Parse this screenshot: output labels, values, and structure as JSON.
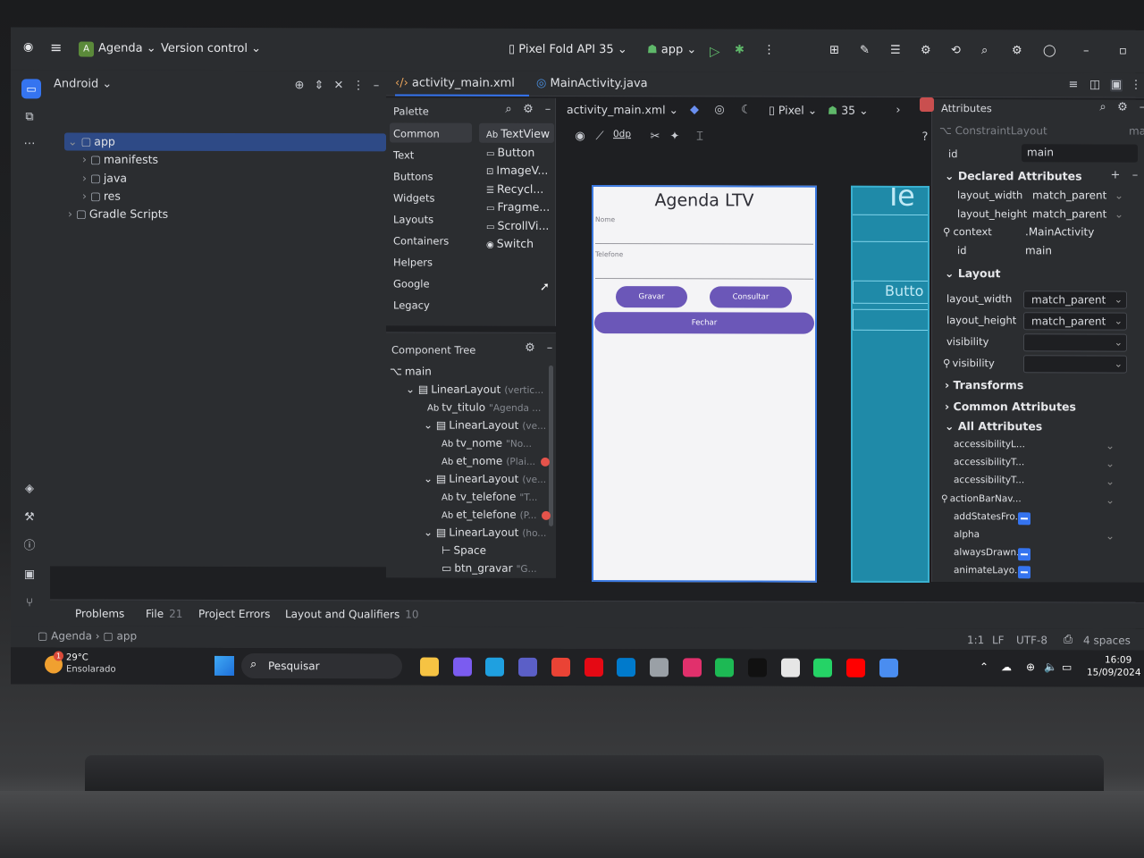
{
  "titlebar": {
    "project_badge": "A",
    "project_name": "Agenda",
    "version_control": "Version control",
    "device": "Pixel Fold API 35",
    "run_config": "app"
  },
  "project_panel": {
    "view_mode": "Android",
    "tree": [
      {
        "label": "app",
        "level": 0,
        "expanded": true,
        "selected": true
      },
      {
        "label": "manifests",
        "level": 1
      },
      {
        "label": "java",
        "level": 1
      },
      {
        "label": "res",
        "level": 1
      },
      {
        "label": "Gradle Scripts",
        "level": 0
      }
    ]
  },
  "editor_tabs": [
    {
      "label": "activity_main.xml",
      "active": true
    },
    {
      "label": "MainActivity.java",
      "active": false
    }
  ],
  "palette": {
    "title": "Palette",
    "categories": [
      "Common",
      "Text",
      "Buttons",
      "Widgets",
      "Layouts",
      "Containers",
      "Helpers",
      "Google",
      "Legacy"
    ],
    "items": [
      "TextView",
      "Button",
      "ImageV...",
      "Recycl...",
      "Fragme...",
      "ScrollVi...",
      "Switch"
    ]
  },
  "design_toolbar": {
    "file": "activity_main.xml",
    "device": "Pixel",
    "api": "35",
    "margin": "0dp"
  },
  "component_tree": {
    "title": "Component Tree",
    "rows": [
      {
        "name": "main",
        "hint": "",
        "indent": 0,
        "error": false
      },
      {
        "name": "LinearLayout",
        "hint": "(vertic...",
        "indent": 1,
        "error": false
      },
      {
        "name": "tv_titulo",
        "hint": "\"Agenda ...",
        "indent": 2,
        "error": false
      },
      {
        "name": "LinearLayout",
        "hint": "(ve...",
        "indent": 2,
        "error": false
      },
      {
        "name": "tv_nome",
        "hint": "\"No...",
        "indent": 3,
        "error": false
      },
      {
        "name": "et_nome",
        "hint": "(Plai...",
        "indent": 3,
        "error": true
      },
      {
        "name": "LinearLayout",
        "hint": "(ve...",
        "indent": 2,
        "error": false
      },
      {
        "name": "tv_telefone",
        "hint": "\"T...",
        "indent": 3,
        "error": false
      },
      {
        "name": "et_telefone",
        "hint": "(P...",
        "indent": 3,
        "error": true
      },
      {
        "name": "LinearLayout",
        "hint": "(ho...",
        "indent": 2,
        "error": false
      },
      {
        "name": "Space",
        "hint": "",
        "indent": 3,
        "error": false
      },
      {
        "name": "btn_gravar",
        "hint": "\"G...",
        "indent": 3,
        "error": false
      }
    ]
  },
  "preview": {
    "title": "Agenda LTV",
    "field1_label": "Nome",
    "field2_label": "Telefone",
    "btn_gravar": "Gravar",
    "btn_consultar": "Consultar",
    "btn_fechar": "Fechar",
    "blueprint_title": "Te",
    "blueprint_button": "Butto"
  },
  "attributes": {
    "title": "Attributes",
    "component": "ConstraintLayout",
    "component_right": "main",
    "id_label": "id",
    "id_value": "main",
    "declared_title": "Declared Attributes",
    "declared": [
      {
        "name": "layout_width",
        "value": "match_parent"
      },
      {
        "name": "layout_height",
        "value": "match_parent"
      },
      {
        "name": "context",
        "value": ".MainActivity"
      },
      {
        "name": "id",
        "value": "main"
      }
    ],
    "layout_title": "Layout",
    "layout": [
      {
        "name": "layout_width",
        "value": "match_parent"
      },
      {
        "name": "layout_height",
        "value": "match_parent"
      },
      {
        "name": "visibility",
        "value": ""
      },
      {
        "name": "visibility",
        "value": ""
      }
    ],
    "transforms_title": "Transforms",
    "common_title": "Common Attributes",
    "all_title": "All Attributes",
    "all": [
      {
        "name": "accessibilityL...",
        "flag": false
      },
      {
        "name": "accessibilityT...",
        "flag": false
      },
      {
        "name": "accessibilityT...",
        "flag": false
      },
      {
        "name": "actionBarNav...",
        "flag": false
      },
      {
        "name": "addStatesFro...",
        "flag": true
      },
      {
        "name": "alpha",
        "flag": false
      },
      {
        "name": "alwaysDrawn...",
        "flag": true
      },
      {
        "name": "animateLayo...",
        "flag": true
      }
    ]
  },
  "bottom_tabs": [
    {
      "label": "Problems",
      "count": ""
    },
    {
      "label": "File",
      "count": "21"
    },
    {
      "label": "Project Errors",
      "count": ""
    },
    {
      "label": "Layout and Qualifiers",
      "count": "10"
    }
  ],
  "status": {
    "crumb1": "Agenda",
    "crumb2": "app",
    "position": "1:1",
    "line_sep": "LF",
    "encoding": "UTF-8",
    "indent": "4 spaces"
  },
  "taskbar": {
    "weather_temp": "29°C",
    "weather_desc": "Ensolarado",
    "weather_badge": "1",
    "search": "Pesquisar",
    "time": "16:09",
    "date": "15/09/2024",
    "apps": [
      "file-explorer",
      "copilot",
      "edge",
      "teams",
      "chrome",
      "netflix",
      "vscode",
      "app",
      "instagram",
      "spotify",
      "tiktok",
      "roblox",
      "whatsapp",
      "youtube",
      "android-studio"
    ]
  }
}
